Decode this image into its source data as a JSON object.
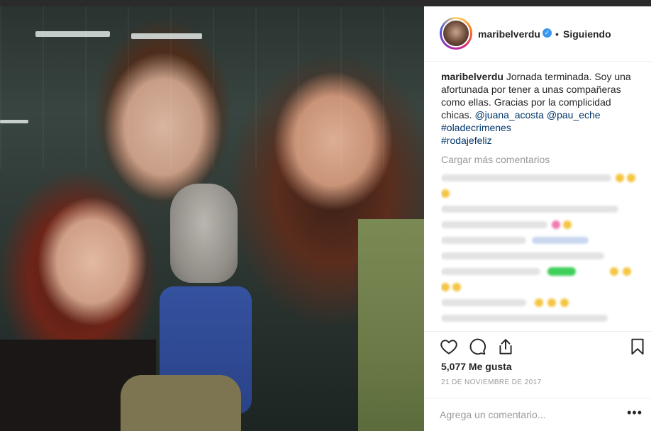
{
  "post": {
    "username": "maribelverdu",
    "follow_status": "Siguiendo",
    "dot": "•",
    "verified_mark": "✓"
  },
  "caption": {
    "username": "maribelverdu",
    "text": "Jornada terminada. Soy una afortunada por tener a unas compañeras como ellas. Gracias por la complicidad chicas.",
    "mention1": "@juana_acosta",
    "mention2": "@pau_eche",
    "hashtag1": "#oladecrimenes",
    "hashtag2": "#rodajefeliz"
  },
  "comments": {
    "load_more": "Cargar más comentarios"
  },
  "actions": {
    "like_icon": "heart-icon",
    "comment_icon": "comment-icon",
    "share_icon": "share-icon",
    "save_icon": "bookmark-icon"
  },
  "likes": "5,077 Me gusta",
  "date": "21 DE NOVIEMBRE DE 2017",
  "comment_box": {
    "placeholder": "Agrega un comentario...",
    "more": "•••"
  },
  "colors": {
    "link": "#003569",
    "muted": "#999999",
    "verified": "#3897f0"
  }
}
